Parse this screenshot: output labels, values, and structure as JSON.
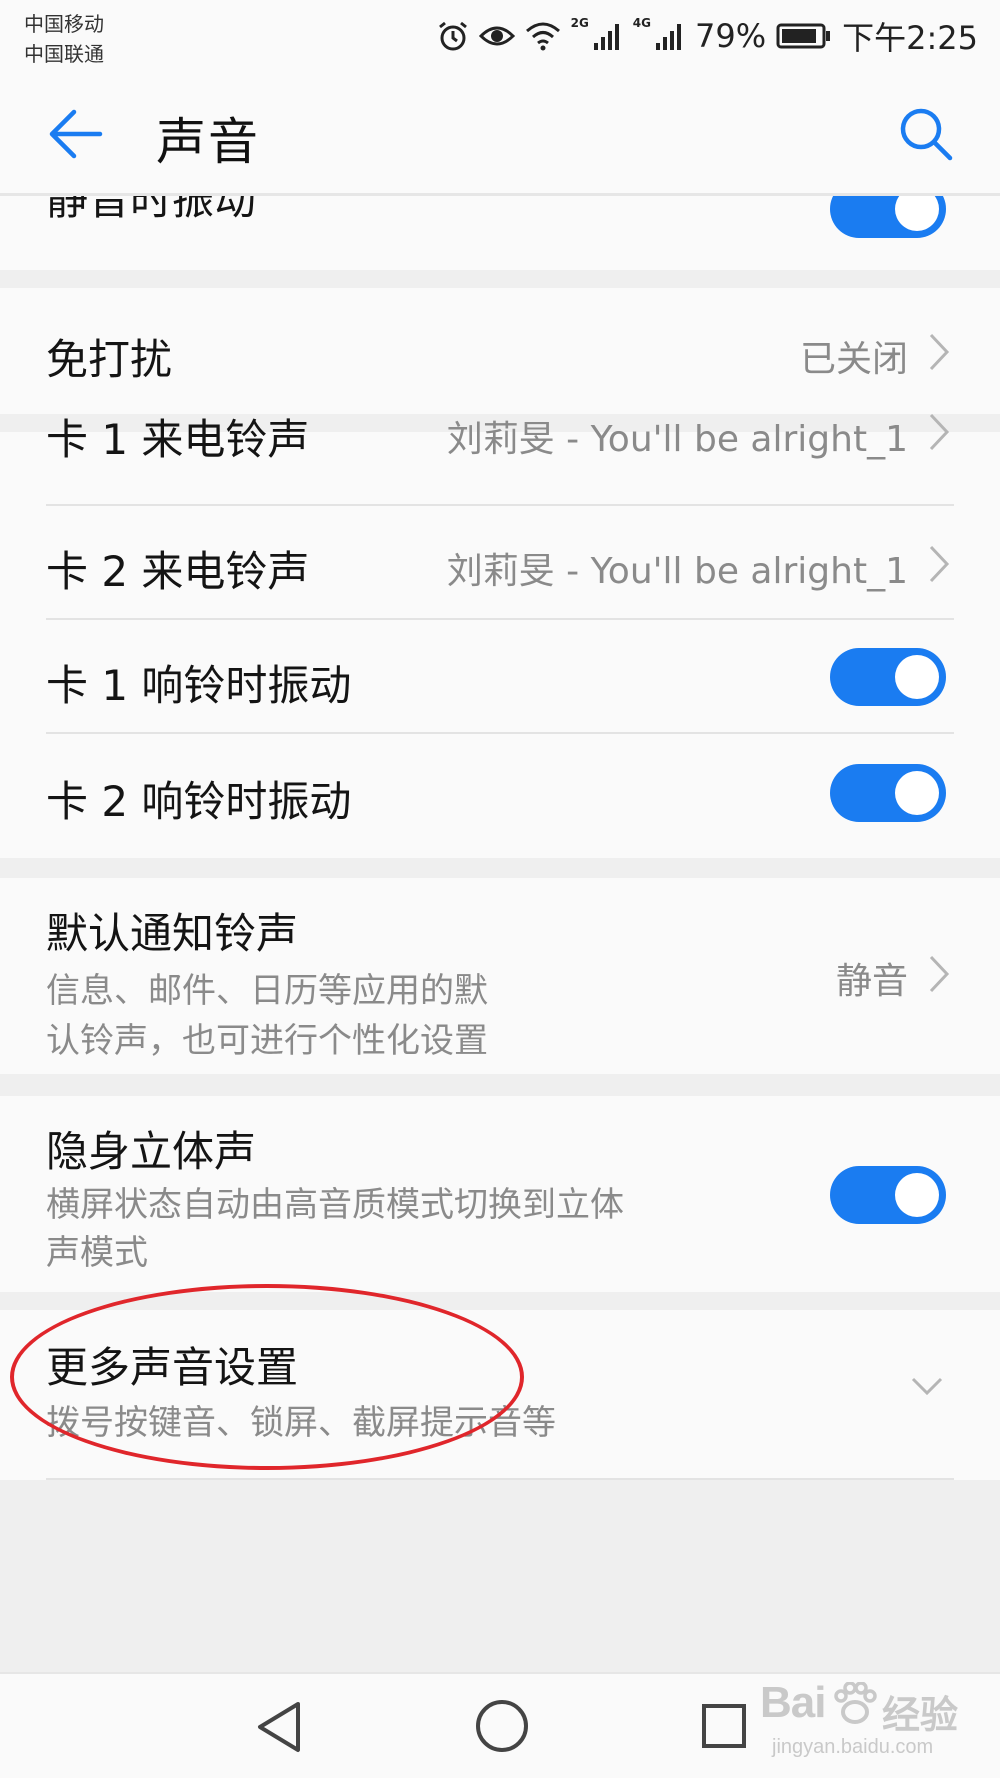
{
  "status_bar": {
    "carrier_1": "中国移动",
    "carrier_2": "中国联通",
    "network_1": "2G",
    "network_2": "4G",
    "battery": "79%",
    "time": "下午2:25",
    "icons": [
      "alarm-icon",
      "eye-comfort-icon",
      "wifi-icon",
      "signal-icon",
      "battery-icon"
    ]
  },
  "app_bar": {
    "title": "声音",
    "back_icon": "arrow-left-icon",
    "search_icon": "search-icon"
  },
  "settings": {
    "vibrate_when_silent": {
      "label": "静音时振动",
      "enabled": true
    },
    "do_not_disturb": {
      "label": "免打扰",
      "value": "已关闭"
    },
    "sim1_ringtone": {
      "label": "卡 1 来电铃声",
      "value": "刘莉旻 - You'll be alright_1"
    },
    "sim2_ringtone": {
      "label": "卡 2 来电铃声",
      "value": "刘莉旻 - You'll be alright_1"
    },
    "sim1_vibrate": {
      "label": "卡 1 响铃时振动",
      "enabled": true
    },
    "sim2_vibrate": {
      "label": "卡 2 响铃时振动",
      "enabled": true
    },
    "default_notification": {
      "label": "默认通知铃声",
      "subtitle_line1": "信息、邮件、日历等应用的默",
      "subtitle_line2": "认铃声，也可进行个性化设置",
      "value": "静音"
    },
    "stealth_stereo": {
      "label": "隐身立体声",
      "subtitle_line1": "横屏状态自动由高音质模式切换到立体",
      "subtitle_line2": "声模式",
      "enabled": true
    },
    "more_sound_settings": {
      "label": "更多声音设置",
      "subtitle": "拨号按键音、锁屏、截屏提示音等"
    }
  },
  "nav_bar": {
    "icons": [
      "nav-back-icon",
      "nav-home-icon",
      "nav-recents-icon"
    ]
  },
  "watermark": {
    "logo_text": "Bai",
    "brand": "经验",
    "url": "jingyan.baidu.com"
  },
  "colors": {
    "accent": "#1a7cf1",
    "annotation": "#e0262b",
    "secondary_text": "#8a8a8a",
    "background": "#efefef"
  }
}
